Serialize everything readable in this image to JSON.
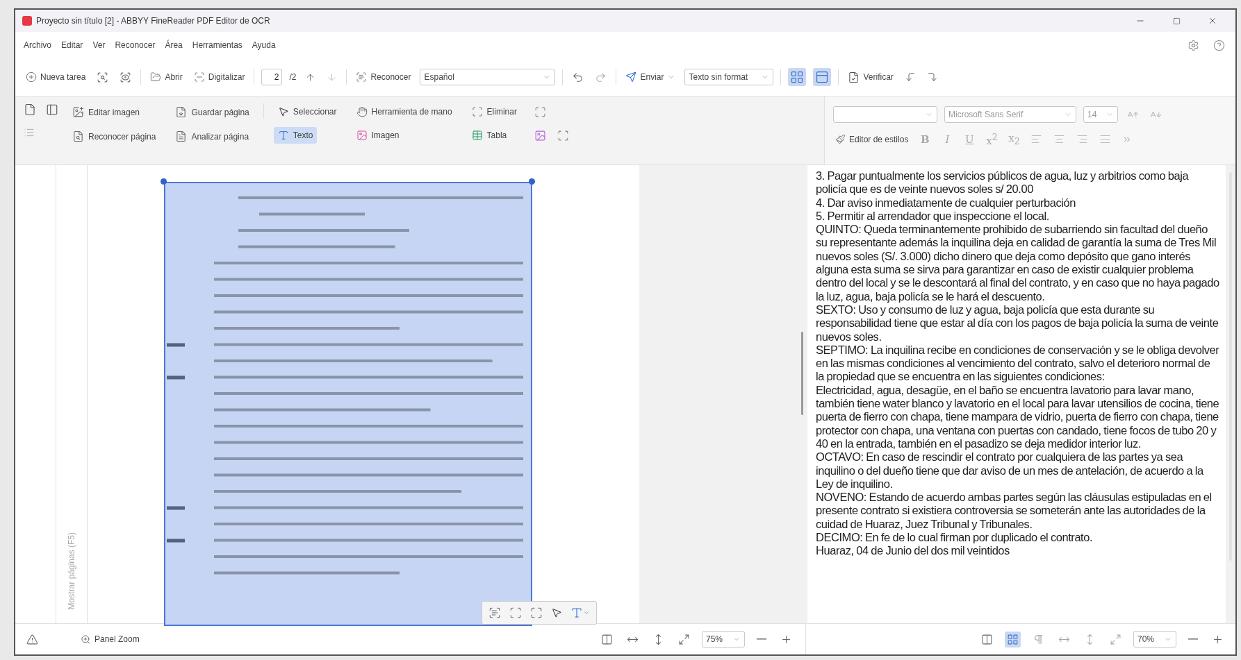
{
  "window": {
    "title": "Proyecto sin título [2] - ABBYY FineReader PDF Editor de OCR"
  },
  "menu": [
    "Archivo",
    "Editar",
    "Ver",
    "Reconocer",
    "Área",
    "Herramientas",
    "Ayuda"
  ],
  "toolbar": {
    "new_task": "Nueva tarea",
    "open": "Abrir",
    "scan": "Digitalizar",
    "page": "2",
    "page_total": "/2",
    "recognize": "Reconocer",
    "language": "Español",
    "send": "Enviar",
    "format": "Texto sin format",
    "verify": "Verificar",
    "views": [
      {
        "selected": true
      },
      {
        "selected": true
      }
    ]
  },
  "image_tools": [
    "Editar imagen",
    "Guardar página",
    "Reconocer página",
    "Analizar página"
  ],
  "area_tools": [
    {
      "label": "Seleccionar",
      "selected": false
    },
    {
      "label": "Herramienta de mano",
      "selected": false
    },
    {
      "label": "Eliminar",
      "selected": false
    },
    {
      "label": "Texto",
      "selected": true
    },
    {
      "label": "Imagen",
      "selected": false
    },
    {
      "label": "Tabla",
      "selected": false
    }
  ],
  "pages_panel": {
    "label": "Mostrar páginas (F5)"
  },
  "text_editor": {
    "font": "Microsoft Sans Serif",
    "size": "14",
    "styles_button": "Editor de estilos",
    "format_buttons": [
      "B",
      "I",
      "U",
      "x$^{2}$",
      "x$_{2}$"
    ],
    "paragraphs": [
      "3. Pagar puntualmente los servicios públicos de agua, luz y arbitrios como baja policía que es de veinte nuevos soles s/ 20.00",
      "4. Dar aviso inmediatamente de cualquier perturbación",
      "5. Permitir al arrendador que inspeccione el local.",
      "QUINTO: Queda terminantemente prohibido de subarriendo sin facultad del dueño su representante además la inquilina deja en calidad de garantía la suma de Tres Mil nuevos soles (S/. 3.000) dicho dinero que deja como depósito que gano interés alguna esta suma se sirva para garantizar en caso de existir cualquier problema dentro del local y se le descontará al final del contrato, y en caso que no haya pagado la luz, agua, baja policía se le hará el descuento.",
      "SEXTO: Uso y consumo de luz y agua, baja policía que esta durante su responsabilidad tiene que estar al día con los pagos de baja policía la suma de veinte nuevos soles.",
      "SEPTIMO: La inquilina recibe en condiciones de conservación y se le obliga devolver en las mismas condiciones al vencimiento del contrato, salvo el deterioro normal de la propiedad que se encuentra en las siguientes condiciones:",
      "Electricidad, agua, desagüe, en el baño se encuentra lavatorio para lavar mano, también tiene water blanco y lavatorio en el local para lavar utensilios de cocina, tiene puerta de fierro con chapa, tiene mampara de vidrio, puerta de fierro con chapa, tiene protector con chapa, una ventana con puertas con candado, tiene focos de tubo 20 y 40 en la entrada, también en el pasadizo se deja medidor interior luz.",
      "OCTAVO: En caso de rescindir el contrato por cualquiera de las partes ya sea inquilino o del dueño tiene que dar aviso de un mes de antelación, de acuerdo a la Ley de inquilino.",
      "NOVENO: Estando de acuerdo ambas partes según las cláusulas estipuladas en el presente contrato si existiera controversia se someterán ante las autoridades de la cuidad de Huaraz, Juez Tribunal y Tribunales.",
      "DECIMO: En fe de lo cual firman por duplicado el contrato.",
      "Huaraz, 04 de Junio del dos mil veintidos"
    ]
  },
  "status_left": {
    "zoom_panel": "Panel Zoom",
    "zoom": "75%"
  },
  "status_right": {
    "zoom": "70%"
  }
}
